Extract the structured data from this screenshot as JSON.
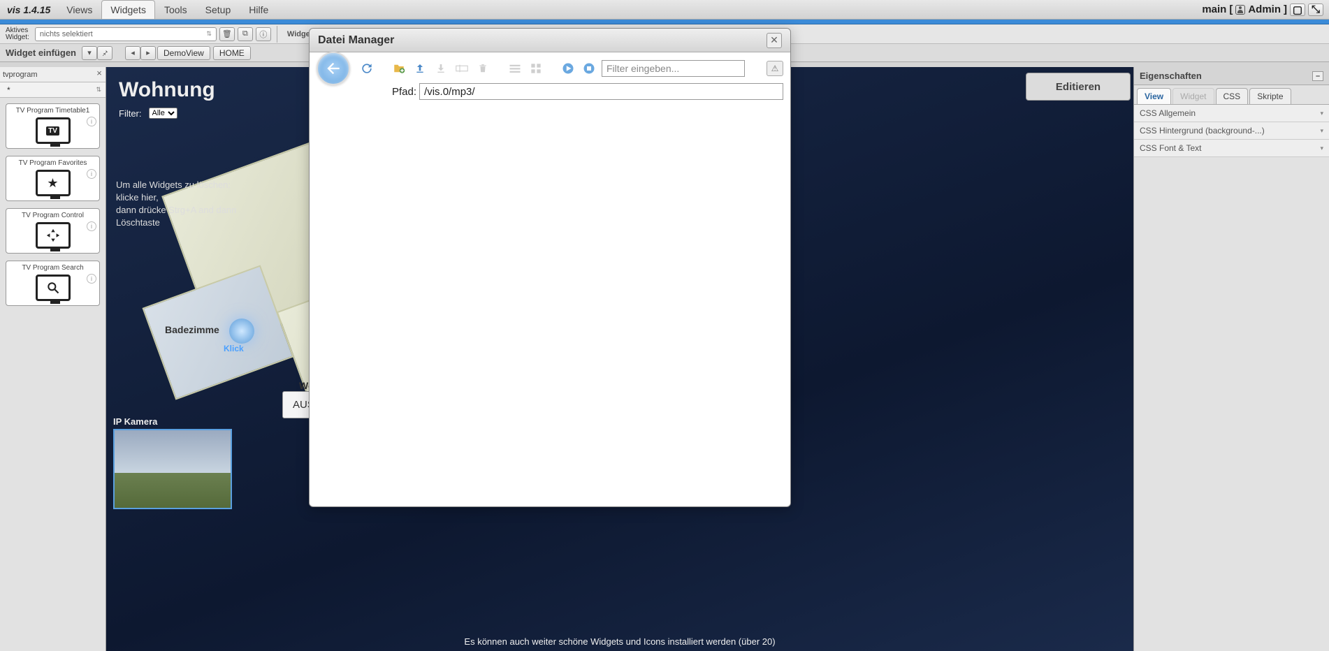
{
  "app": {
    "title": "vis 1.4.15"
  },
  "menu": {
    "views": "Views",
    "widgets": "Widgets",
    "tools": "Tools",
    "setup": "Setup",
    "help": "Hilfe"
  },
  "topright": {
    "main": "main",
    "user": "Admin"
  },
  "activeWidget": {
    "label1": "Aktives",
    "label2": "Widget:",
    "value": "nichts selektiert"
  },
  "alignPanel": "Widgets a",
  "insertRow": {
    "label": "Widget einfügen",
    "tab1": "DemoView",
    "tab2": "HOME"
  },
  "leftFilter": {
    "name": "tvprogram",
    "star": "*"
  },
  "widgets": [
    {
      "name": "TV Program Timetable1",
      "iconText": "TV"
    },
    {
      "name": "TV Program Favorites",
      "iconText": "★"
    },
    {
      "name": "TV Program Control",
      "iconText": "✦"
    },
    {
      "name": "TV Program Search",
      "iconText": ""
    }
  ],
  "canvas": {
    "title": "Wohnung",
    "filterLabel": "Filter:",
    "filterValue": "Alle",
    "hint": "Um alle Widgets zu löschen:\nklicke hier,\ndann drücke Strg+A and dann Löschtaste",
    "room1": "Badezimme",
    "room2": "Woh",
    "klick": "Klick",
    "ausBtn": "AUS",
    "camLabel": "IP Kamera",
    "footer": "Es können auch weiter schöne Widgets und Icons installiert werden (über 20)"
  },
  "editBtn": "Editieren",
  "rightPanel": {
    "title": "Eigenschaften",
    "tabs": {
      "view": "View",
      "widget": "Widget",
      "css": "CSS",
      "scripts": "Skripte"
    },
    "acc1": "CSS Allgemein",
    "acc2": "CSS Hintergrund (background-...)",
    "acc3": "CSS Font & Text"
  },
  "dialog": {
    "title": "Datei Manager",
    "pathLabel": "Pfad:",
    "pathValue": "/vis.0/mp3/",
    "filterPlaceholder": "Filter eingeben..."
  }
}
